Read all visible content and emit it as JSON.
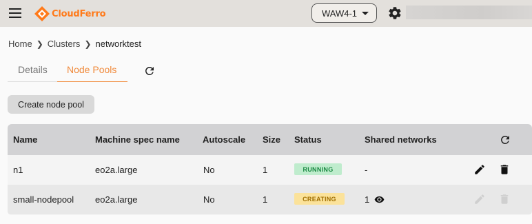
{
  "header": {
    "brand": "CloudFerro",
    "region": "WAW4-1",
    "colors": {
      "topbar": "#e3e0dc",
      "accent": "#f0893a"
    }
  },
  "breadcrumb": {
    "items": [
      "Home",
      "Clusters",
      "networktest"
    ]
  },
  "tabs": [
    {
      "label": "Details",
      "active": false
    },
    {
      "label": "Node Pools",
      "active": true
    }
  ],
  "actions": {
    "create_label": "Create node pool"
  },
  "table": {
    "columns": [
      "Name",
      "Machine spec name",
      "Autoscale",
      "Size",
      "Status",
      "Shared networks"
    ],
    "rows": [
      {
        "name": "n1",
        "machine": "eo2a.large",
        "autoscale": "No",
        "size": "1",
        "status": "RUNNING",
        "shared": "-",
        "actions_enabled": true
      },
      {
        "name": "small-nodepool",
        "machine": "eo2a.large",
        "autoscale": "No",
        "size": "1",
        "status": "CREATING",
        "shared": "1",
        "actions_enabled": false
      }
    ],
    "status_colors": {
      "RUNNING": "#1b8a43",
      "CREATING": "#a06f00"
    }
  }
}
